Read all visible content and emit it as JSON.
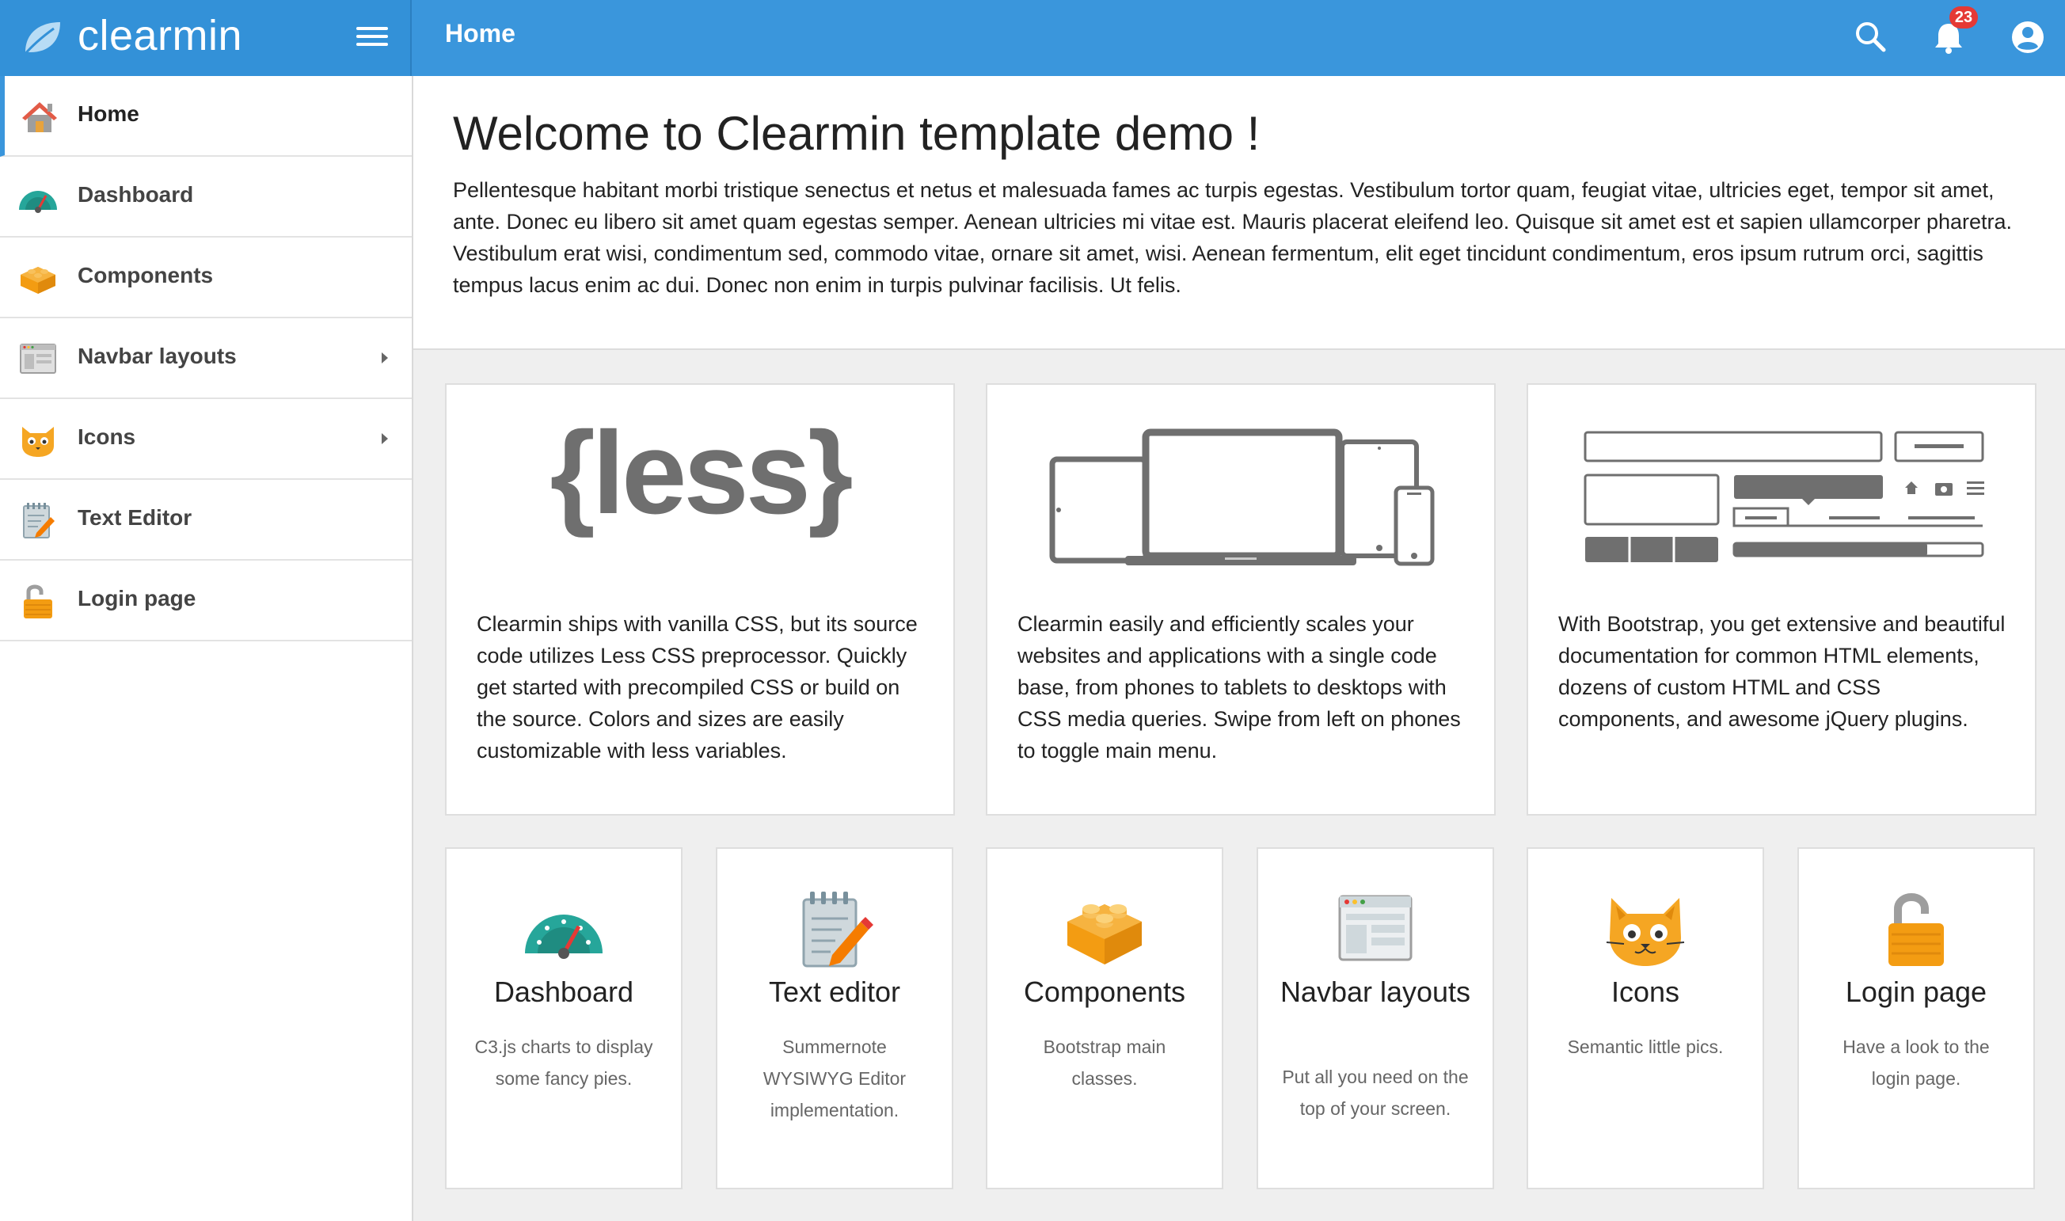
{
  "app": {
    "brand": "clearmin",
    "page_title": "Home",
    "notification_count": "23"
  },
  "sidebar": {
    "items": [
      {
        "label": "Home",
        "icon": "house-icon",
        "active": true
      },
      {
        "label": "Dashboard",
        "icon": "speedometer-icon"
      },
      {
        "label": "Components",
        "icon": "lego-brick-icon"
      },
      {
        "label": "Navbar layouts",
        "icon": "browser-window-icon",
        "submenu": true
      },
      {
        "label": "Icons",
        "icon": "cat-face-icon",
        "submenu": true
      },
      {
        "label": "Text Editor",
        "icon": "notepad-pencil-icon"
      },
      {
        "label": "Login page",
        "icon": "open-padlock-icon"
      }
    ]
  },
  "welcome": {
    "title": "Welcome to Clearmin template demo !",
    "body": "Pellentesque habitant morbi tristique senectus et netus et malesuada fames ac turpis egestas. Vestibulum tortor quam, feugiat vitae, ultricies eget, tempor sit amet, ante. Donec eu libero sit amet quam egestas semper. Aenean ultricies mi vitae est. Mauris placerat eleifend leo. Quisque sit amet est et sapien ullamcorper pharetra. Vestibulum erat wisi, condimentum sed, commodo vitae, ornare sit amet, wisi. Aenean fermentum, elit eget tincidunt condimentum, eros ipsum rutrum orci, sagittis tempus lacus enim ac dui. Donec non enim in turpis pulvinar facilisis. Ut felis."
  },
  "features": [
    {
      "art": "less-logo",
      "logo_text": "{less}",
      "text": "Clearmin ships with vanilla CSS, but its source code utilizes Less CSS preprocessor. Quickly get started with precompiled CSS or build on the source. Colors and sizes are easily customizable with less variables."
    },
    {
      "art": "responsive-devices-illustration",
      "text": "Clearmin easily and efficiently scales your websites and applications with a single code base, from phones to tablets to desktops with CSS media queries. Swipe from left on phones to toggle main menu."
    },
    {
      "art": "ui-components-illustration",
      "text": "With Bootstrap, you get extensive and beautiful documentation for common HTML elements, dozens of custom HTML and CSS components, and awesome jQuery plugins."
    }
  ],
  "tiles": [
    {
      "title": "Dashboard",
      "desc": "C3.js charts to display some fancy pies.",
      "icon": "speedometer-icon"
    },
    {
      "title": "Text editor",
      "desc": "Summernote WYSIWYG Editor implementation.",
      "icon": "notepad-pencil-icon"
    },
    {
      "title": "Components",
      "desc": "Bootstrap main classes.",
      "icon": "lego-brick-icon"
    },
    {
      "title": "Navbar layouts",
      "desc": "Put all you need on the top of your screen.",
      "icon": "browser-window-icon"
    },
    {
      "title": "Icons",
      "desc": "Semantic little pics.",
      "icon": "cat-face-icon"
    },
    {
      "title": "Login page",
      "desc": "Have a look to the login page.",
      "icon": "open-padlock-icon"
    }
  ],
  "colors": {
    "topbar": "#3a96dc",
    "accent": "#3a96dc",
    "badge": "#e53935"
  }
}
